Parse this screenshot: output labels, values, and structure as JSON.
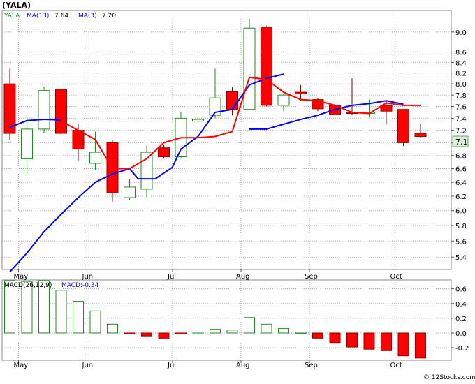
{
  "title": "(YALA)",
  "legend": {
    "ticker": "YALA",
    "ma13_label": "MA(13)",
    "ma13_value": "7.64",
    "ma3_label": "MA(3)",
    "ma3_value": "7.20",
    "macd_label": "MACD(26,12,9)",
    "macd_value_label": "MACD:-0.34"
  },
  "current_price_tag": "7.1",
  "watermark": "© 12Stocks.com",
  "colors": {
    "up": "#228b22",
    "down": "#ff0000",
    "ma13": "#0000ff",
    "ma3": "#ff0000",
    "grid": "#aaaaaa",
    "price_tag_bg": "#ddeedd"
  },
  "chart_data": [
    {
      "type": "candlestick",
      "panel": "price",
      "x_labels": [
        "May",
        "Jun",
        "Jul",
        "Aug",
        "Sep",
        "Oct"
      ],
      "y_ticks": [
        "5.4",
        "5.6",
        "5.8",
        "6.0",
        "6.2",
        "6.4",
        "6.6",
        "6.8",
        "7.0",
        "7.2",
        "7.4",
        "7.6",
        "7.8",
        "8.0",
        "8.2",
        "8.4",
        "8.6",
        "9.0"
      ],
      "y_scale": "log",
      "ylim": [
        5.25,
        9.45
      ],
      "grid": true,
      "candles": [
        {
          "o": 8.0,
          "h": 8.28,
          "l": 7.05,
          "c": 7.15
        },
        {
          "o": 6.75,
          "h": 7.45,
          "l": 6.5,
          "c": 7.22
        },
        {
          "o": 7.22,
          "h": 7.95,
          "l": 7.15,
          "c": 7.88
        },
        {
          "o": 7.9,
          "h": 8.15,
          "l": 5.88,
          "c": 7.15
        },
        {
          "o": 7.2,
          "h": 7.3,
          "l": 6.72,
          "c": 6.9
        },
        {
          "o": 6.68,
          "h": 7.18,
          "l": 6.58,
          "c": 6.85
        },
        {
          "o": 7.0,
          "h": 7.05,
          "l": 6.12,
          "c": 6.25
        },
        {
          "o": 6.18,
          "h": 6.45,
          "l": 6.15,
          "c": 6.33
        },
        {
          "o": 6.3,
          "h": 6.95,
          "l": 6.18,
          "c": 6.85
        },
        {
          "o": 6.92,
          "h": 6.97,
          "l": 6.75,
          "c": 6.78
        },
        {
          "o": 6.78,
          "h": 7.5,
          "l": 6.75,
          "c": 7.4
        },
        {
          "o": 7.35,
          "h": 7.55,
          "l": 7.3,
          "c": 7.38
        },
        {
          "o": 7.45,
          "h": 8.28,
          "l": 7.4,
          "c": 7.75
        },
        {
          "o": 7.86,
          "h": 7.94,
          "l": 7.45,
          "c": 7.55
        },
        {
          "o": 7.55,
          "h": 9.28,
          "l": 7.55,
          "c": 9.08
        },
        {
          "o": 9.1,
          "h": 9.12,
          "l": 7.6,
          "c": 7.62
        },
        {
          "o": 7.62,
          "h": 7.82,
          "l": 7.52,
          "c": 7.8
        },
        {
          "o": 7.85,
          "h": 7.98,
          "l": 7.7,
          "c": 7.82
        },
        {
          "o": 7.72,
          "h": 7.75,
          "l": 7.52,
          "c": 7.56
        },
        {
          "o": 7.62,
          "h": 7.75,
          "l": 7.35,
          "c": 7.46
        },
        {
          "o": 7.5,
          "h": 8.1,
          "l": 7.45,
          "c": 7.48
        },
        {
          "o": 7.48,
          "h": 7.72,
          "l": 7.42,
          "c": 7.5
        },
        {
          "o": 7.62,
          "h": 7.7,
          "l": 7.3,
          "c": 7.52
        },
        {
          "o": 7.55,
          "h": 7.55,
          "l": 6.95,
          "c": 7.0
        },
        {
          "o": 7.15,
          "h": 7.3,
          "l": 7.08,
          "c": 7.1
        }
      ],
      "ma13": [
        5.22,
        5.45,
        5.72,
        5.95,
        6.18,
        6.4,
        6.52,
        6.6,
        6.65,
        6.9,
        7.05,
        7.2,
        7.5,
        7.55,
        7.98,
        8.1,
        8.18,
        null,
        null,
        null,
        null,
        null,
        null,
        null,
        null
      ],
      "ma13_points": [
        [
          0,
          5.22
        ],
        [
          1,
          5.45
        ],
        [
          2,
          5.72
        ],
        [
          3,
          5.95
        ],
        [
          4,
          6.18
        ],
        [
          5,
          6.4
        ],
        [
          6,
          6.52
        ],
        [
          7,
          6.6
        ],
        [
          7.5,
          6.45
        ],
        [
          8.5,
          6.45
        ],
        [
          9.5,
          6.62
        ],
        [
          10,
          6.9
        ],
        [
          11,
          7.1
        ],
        [
          12,
          7.5
        ],
        [
          13,
          7.55
        ],
        [
          14,
          7.98
        ],
        [
          15,
          8.1
        ],
        [
          16,
          8.18
        ]
      ],
      "ma13_points_late": [
        [
          14,
          7.22
        ],
        [
          15,
          7.22
        ],
        [
          16,
          7.3
        ],
        [
          17,
          7.38
        ],
        [
          18,
          7.45
        ],
        [
          19,
          7.55
        ],
        [
          20,
          7.62
        ],
        [
          21,
          7.65
        ],
        [
          22,
          7.7
        ],
        [
          23,
          7.64
        ]
      ],
      "ma3_points": [
        [
          3,
          7.35
        ],
        [
          4,
          7.2
        ],
        [
          5,
          7.05
        ],
        [
          6,
          6.6
        ],
        [
          7,
          6.6
        ],
        [
          8,
          6.75
        ],
        [
          9,
          7.0
        ],
        [
          10,
          7.08
        ],
        [
          11,
          7.08
        ],
        [
          12,
          7.1
        ],
        [
          13,
          7.18
        ],
        [
          14,
          8.12
        ],
        [
          15,
          8.08
        ],
        [
          16,
          7.85
        ],
        [
          17,
          7.72
        ],
        [
          18,
          7.7
        ],
        [
          19,
          7.62
        ],
        [
          20,
          7.5
        ],
        [
          21,
          7.48
        ],
        [
          22,
          7.66
        ],
        [
          23,
          7.62
        ],
        [
          24,
          7.62
        ]
      ],
      "ma13_early_points": [
        [
          0,
          7.25
        ],
        [
          1,
          7.36
        ],
        [
          2,
          7.38
        ],
        [
          3,
          7.37
        ]
      ]
    },
    {
      "type": "bar",
      "panel": "macd",
      "x_labels": [
        "May",
        "Jun",
        "Jul",
        "Aug",
        "Sep",
        "Oct"
      ],
      "y_ticks": [
        "0.6",
        "0.4",
        "0.2",
        "0.0",
        "-0.2"
      ],
      "ylim": [
        -0.37,
        0.72
      ],
      "grid": true,
      "values": [
        0.71,
        0.7,
        0.71,
        0.58,
        0.43,
        0.3,
        0.12,
        -0.01,
        -0.04,
        -0.07,
        -0.01,
        0.0,
        0.05,
        0.04,
        0.21,
        0.12,
        0.06,
        0.01,
        -0.07,
        -0.13,
        -0.19,
        -0.22,
        -0.24,
        -0.31,
        -0.34
      ]
    }
  ]
}
